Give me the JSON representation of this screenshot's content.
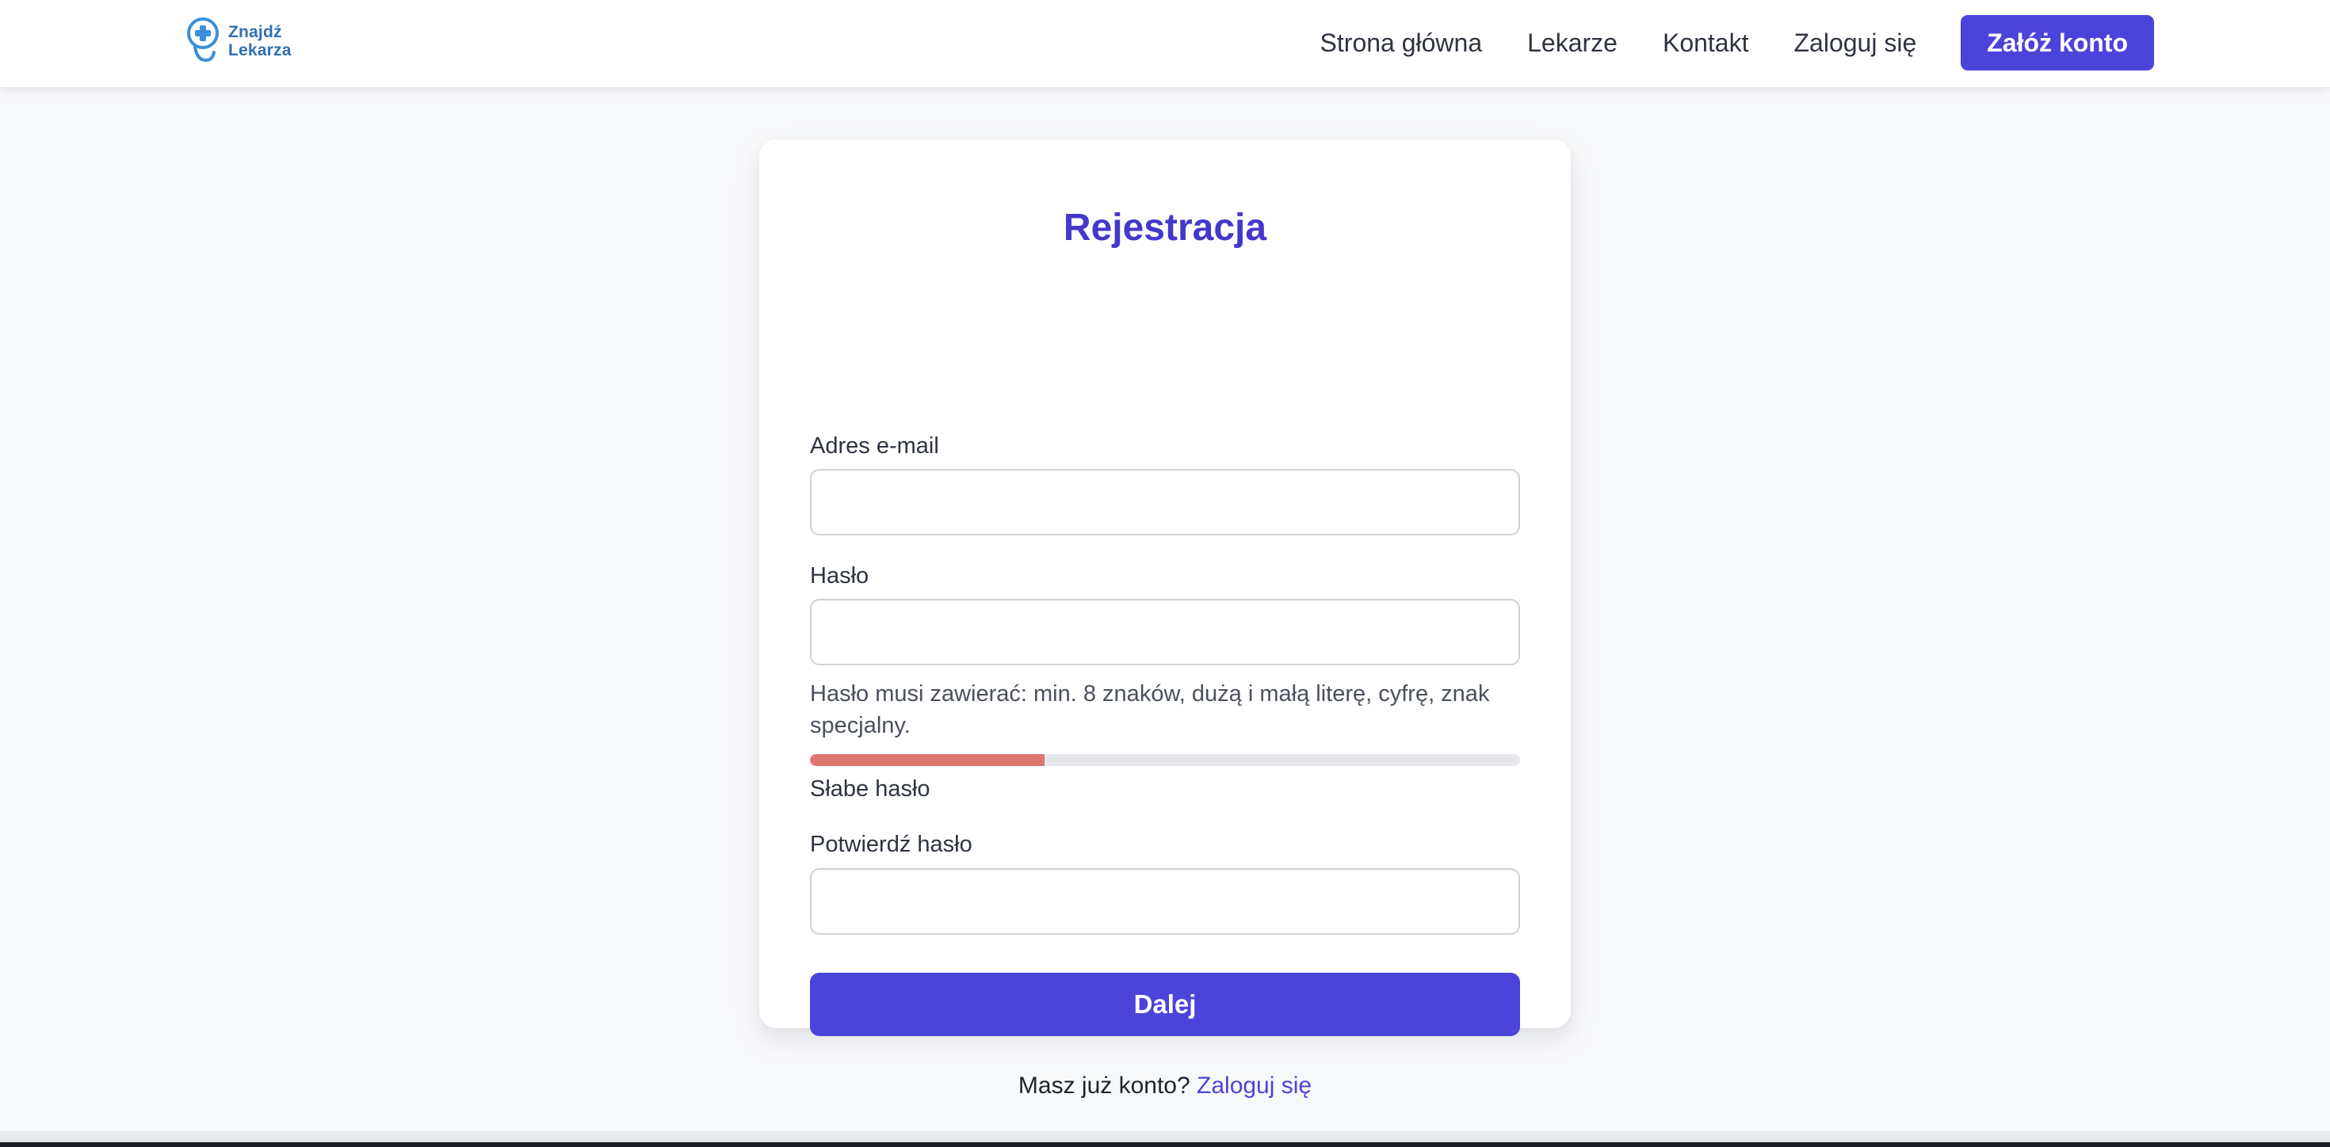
{
  "header": {
    "logo": {
      "line1": "Znajdź",
      "line2": "Lekarza",
      "icon": "stethoscope-plus-icon",
      "color": "#2f6fb4"
    },
    "nav": [
      {
        "label": "Strona główna"
      },
      {
        "label": "Lekarze"
      },
      {
        "label": "Kontakt"
      },
      {
        "label": "Zaloguj się"
      }
    ],
    "cta_label": "Załóż konto"
  },
  "form": {
    "title": "Rejestracja",
    "email": {
      "label": "Adres e-mail",
      "value": "",
      "placeholder": ""
    },
    "password": {
      "label": "Hasło",
      "value": "",
      "placeholder": ""
    },
    "password_hint": "Hasło musi zawierać: min. 8 znaków, dużą i małą literę, cyfrę, znak specjalny.",
    "strength": {
      "label": "Słabe hasło",
      "level_fraction": 0.33,
      "color": "#e07470"
    },
    "confirm": {
      "label": "Potwierdź hasło",
      "value": "",
      "placeholder": ""
    },
    "submit_label": "Dalej",
    "login_prompt": "Masz już konto?",
    "login_link": "Zaloguj się"
  },
  "colors": {
    "accent": "#4b44da",
    "title": "#4338ca",
    "background": "#f8f9fb"
  }
}
